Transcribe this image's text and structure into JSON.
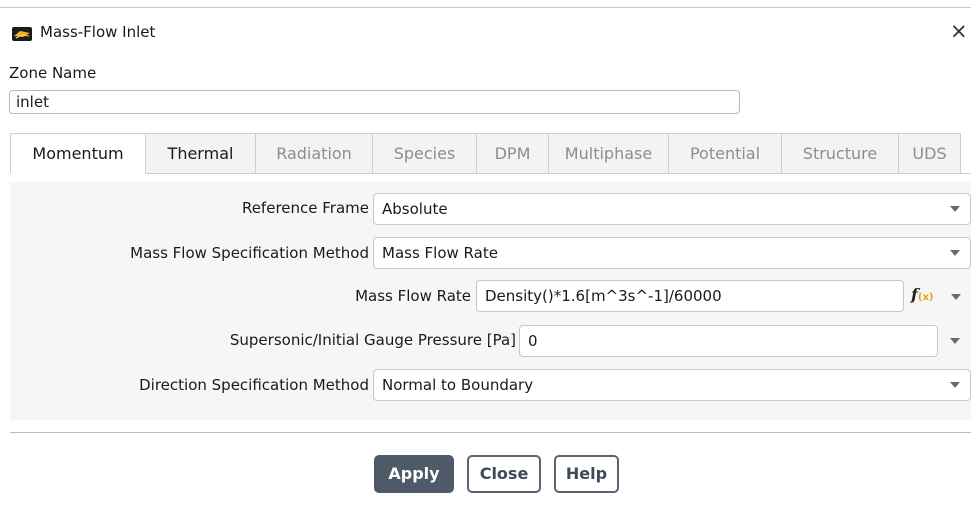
{
  "window": {
    "title": "Mass-Flow Inlet",
    "close_glyph": "×"
  },
  "zone": {
    "label": "Zone Name",
    "value": "inlet"
  },
  "tabs": [
    {
      "label": "Momentum",
      "state": "active"
    },
    {
      "label": "Thermal",
      "state": "enabled"
    },
    {
      "label": "Radiation",
      "state": "disabled"
    },
    {
      "label": "Species",
      "state": "disabled"
    },
    {
      "label": "DPM",
      "state": "disabled"
    },
    {
      "label": "Multiphase",
      "state": "disabled"
    },
    {
      "label": "Potential",
      "state": "disabled"
    },
    {
      "label": "Structure",
      "state": "disabled"
    },
    {
      "label": "UDS",
      "state": "disabled"
    }
  ],
  "form": {
    "reference_frame": {
      "label": "Reference Frame",
      "value": "Absolute"
    },
    "mass_flow_method": {
      "label": "Mass Flow Specification Method",
      "value": "Mass Flow Rate"
    },
    "mass_flow_rate": {
      "label": "Mass Flow Rate",
      "value": "Density()*1.6[m^3s^-1]/60000",
      "expression_icon": "fx-expression-icon"
    },
    "gauge_pressure": {
      "label": "Supersonic/Initial Gauge Pressure [Pa]",
      "value": "0"
    },
    "direction_method": {
      "label": "Direction Specification Method",
      "value": "Normal to Boundary"
    }
  },
  "buttons": {
    "apply": "Apply",
    "close": "Close",
    "help": "Help"
  },
  "colors": {
    "primary_button": "#4f5a68",
    "panel_background": "#f6f6f6",
    "fx_accent": "#e8a21a"
  }
}
